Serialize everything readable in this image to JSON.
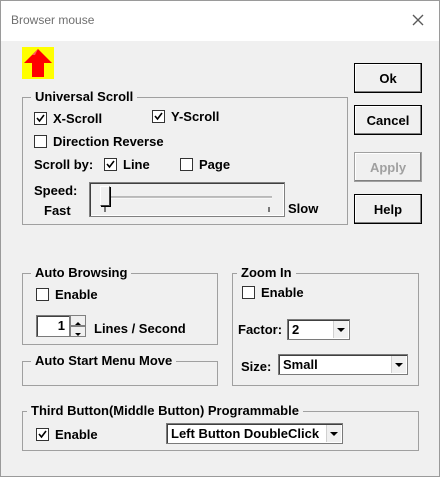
{
  "window": {
    "title": "Browser mouse"
  },
  "buttons": {
    "ok": "Ok",
    "cancel": "Cancel",
    "apply": "Apply",
    "help": "Help"
  },
  "universal_scroll": {
    "legend": "Universal Scroll",
    "x_scroll": {
      "label": "X-Scroll",
      "checked": true
    },
    "y_scroll": {
      "label": "Y-Scroll",
      "checked": true
    },
    "direction_reverse": {
      "label": "Direction Reverse",
      "checked": false
    },
    "scroll_by_label": "Scroll by:",
    "line": {
      "label": "Line",
      "checked": true
    },
    "page": {
      "label": "Page",
      "checked": false
    },
    "speed_label": "Speed:",
    "fast_label": "Fast",
    "slow_label": "Slow",
    "speed_level": 0
  },
  "auto_browsing": {
    "legend": "Auto Browsing",
    "enable": {
      "label": "Enable",
      "checked": false
    },
    "lines_value": "1",
    "lines_label": "Lines / Second"
  },
  "auto_start_menu": {
    "legend": "Auto Start Menu Move"
  },
  "zoom_in": {
    "legend": "Zoom In",
    "enable": {
      "label": "Enable",
      "checked": false
    },
    "factor_label": "Factor:",
    "factor_value": "2",
    "size_label": "Size:",
    "size_value": "Small"
  },
  "third_button": {
    "legend": "Third Button(Middle Button) Programmable",
    "enable": {
      "label": "Enable",
      "checked": true
    },
    "action_value": "Left Button DoubleClick"
  },
  "icons": {
    "app_icon": {
      "name": "up-arrow-icon",
      "bg": "#ffff00",
      "fg": "#ff0000"
    },
    "close": "close-icon",
    "check": "check-icon",
    "dropdown": "chevron-down-icon"
  }
}
